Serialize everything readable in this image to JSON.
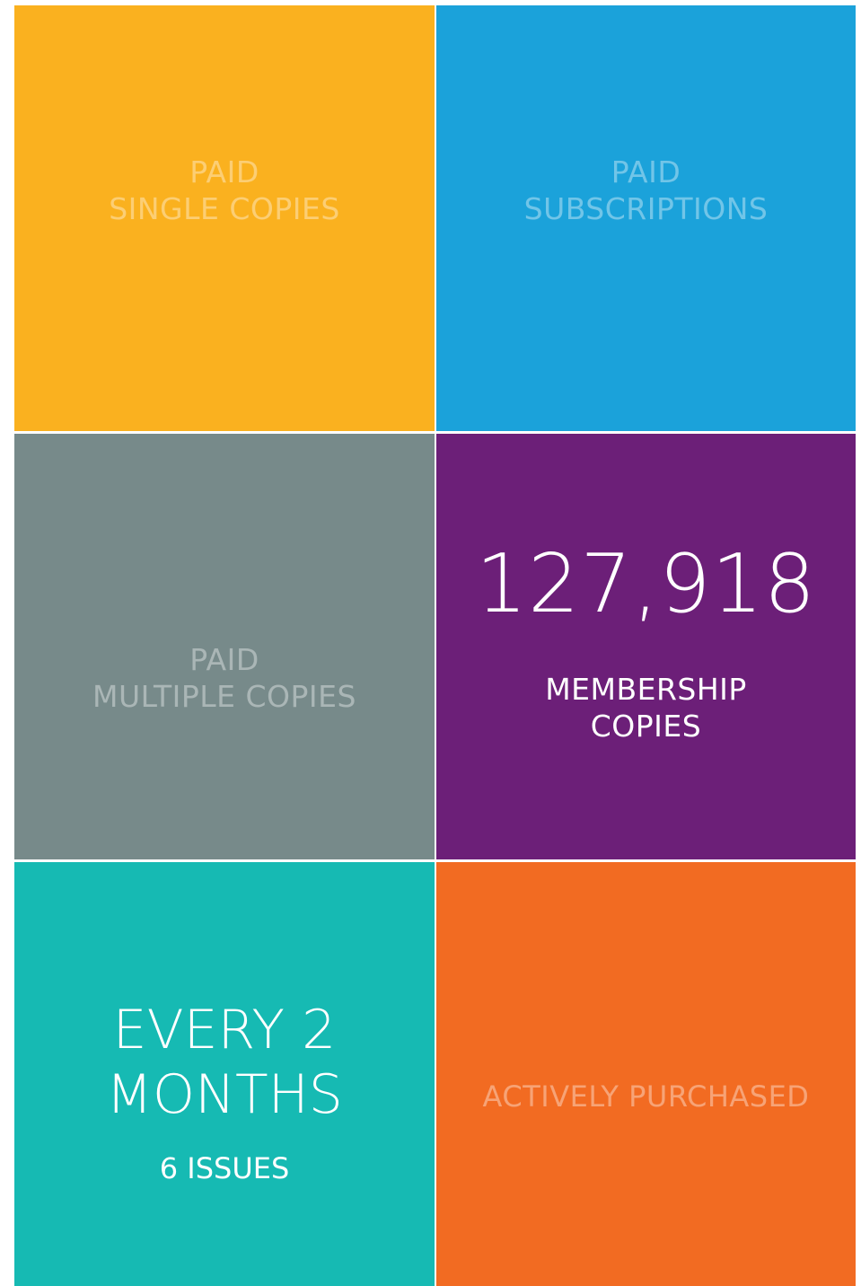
{
  "tiles": {
    "single": {
      "color": "#FAB11F",
      "line1": "PAID",
      "line2": "SINGLE COPIES"
    },
    "subscriptions": {
      "color": "#1BA2DA",
      "line1": "PAID",
      "line2": "SUBSCRIPTIONS"
    },
    "multiple": {
      "color": "#778A8A",
      "line1": "PAID",
      "line2": "MULTIPLE COPIES"
    },
    "membership": {
      "color": "#6C1F78",
      "value": "127,918",
      "line1": "MEMBERSHIP",
      "line2": "COPIES"
    },
    "frequency": {
      "color": "#16BAB3",
      "line1": "EVERY 2",
      "line2": "MONTHS",
      "sub": "6 ISSUES"
    },
    "purchased": {
      "color": "#F26B22",
      "label": "ACTIVELY PURCHASED"
    }
  }
}
